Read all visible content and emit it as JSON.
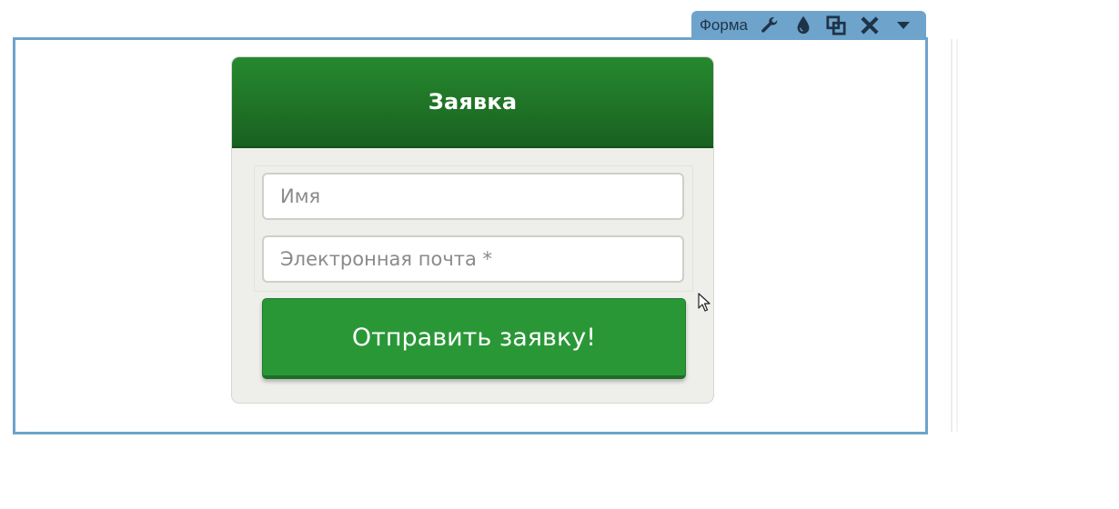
{
  "toolbar": {
    "label": "Форма",
    "icons": [
      "wrench-icon",
      "droplet-icon",
      "duplicate-icon",
      "close-icon",
      "dropdown-arrow-icon"
    ],
    "background": "#6ea3cc"
  },
  "form": {
    "title": "Заявка",
    "header_color": "#1f7326",
    "fields": {
      "name_placeholder": "Имя",
      "email_placeholder": "Электронная почта *"
    },
    "submit_label": "Отправить заявку!",
    "button_color": "#2a9737"
  }
}
